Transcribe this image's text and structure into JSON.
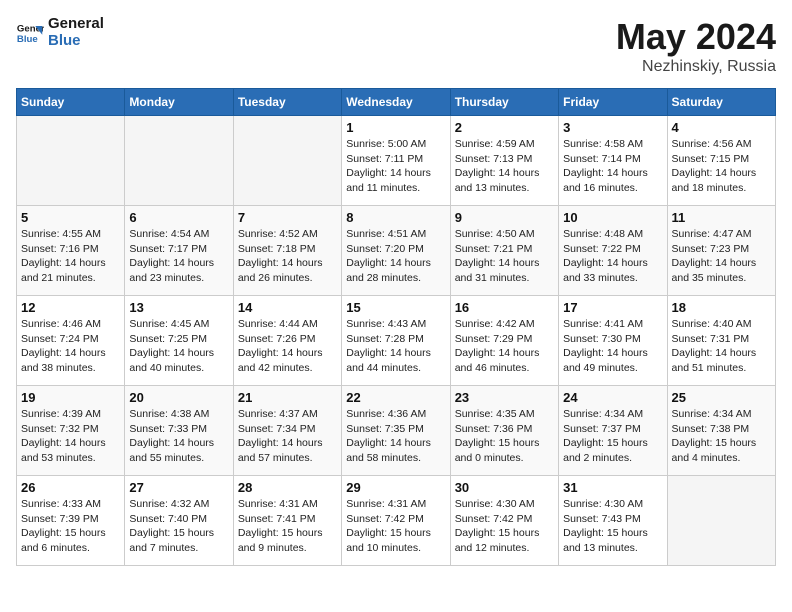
{
  "header": {
    "logo_line1": "General",
    "logo_line2": "Blue",
    "title": "May 2024",
    "location": "Nezhinskiy, Russia"
  },
  "weekdays": [
    "Sunday",
    "Monday",
    "Tuesday",
    "Wednesday",
    "Thursday",
    "Friday",
    "Saturday"
  ],
  "weeks": [
    [
      {
        "day": "",
        "empty": true
      },
      {
        "day": "",
        "empty": true
      },
      {
        "day": "",
        "empty": true
      },
      {
        "day": "1",
        "sunrise": "5:00 AM",
        "sunset": "7:11 PM",
        "daylight": "14 hours and 11 minutes."
      },
      {
        "day": "2",
        "sunrise": "4:59 AM",
        "sunset": "7:13 PM",
        "daylight": "14 hours and 13 minutes."
      },
      {
        "day": "3",
        "sunrise": "4:58 AM",
        "sunset": "7:14 PM",
        "daylight": "14 hours and 16 minutes."
      },
      {
        "day": "4",
        "sunrise": "4:56 AM",
        "sunset": "7:15 PM",
        "daylight": "14 hours and 18 minutes."
      }
    ],
    [
      {
        "day": "5",
        "sunrise": "4:55 AM",
        "sunset": "7:16 PM",
        "daylight": "14 hours and 21 minutes."
      },
      {
        "day": "6",
        "sunrise": "4:54 AM",
        "sunset": "7:17 PM",
        "daylight": "14 hours and 23 minutes."
      },
      {
        "day": "7",
        "sunrise": "4:52 AM",
        "sunset": "7:18 PM",
        "daylight": "14 hours and 26 minutes."
      },
      {
        "day": "8",
        "sunrise": "4:51 AM",
        "sunset": "7:20 PM",
        "daylight": "14 hours and 28 minutes."
      },
      {
        "day": "9",
        "sunrise": "4:50 AM",
        "sunset": "7:21 PM",
        "daylight": "14 hours and 31 minutes."
      },
      {
        "day": "10",
        "sunrise": "4:48 AM",
        "sunset": "7:22 PM",
        "daylight": "14 hours and 33 minutes."
      },
      {
        "day": "11",
        "sunrise": "4:47 AM",
        "sunset": "7:23 PM",
        "daylight": "14 hours and 35 minutes."
      }
    ],
    [
      {
        "day": "12",
        "sunrise": "4:46 AM",
        "sunset": "7:24 PM",
        "daylight": "14 hours and 38 minutes."
      },
      {
        "day": "13",
        "sunrise": "4:45 AM",
        "sunset": "7:25 PM",
        "daylight": "14 hours and 40 minutes."
      },
      {
        "day": "14",
        "sunrise": "4:44 AM",
        "sunset": "7:26 PM",
        "daylight": "14 hours and 42 minutes."
      },
      {
        "day": "15",
        "sunrise": "4:43 AM",
        "sunset": "7:28 PM",
        "daylight": "14 hours and 44 minutes."
      },
      {
        "day": "16",
        "sunrise": "4:42 AM",
        "sunset": "7:29 PM",
        "daylight": "14 hours and 46 minutes."
      },
      {
        "day": "17",
        "sunrise": "4:41 AM",
        "sunset": "7:30 PM",
        "daylight": "14 hours and 49 minutes."
      },
      {
        "day": "18",
        "sunrise": "4:40 AM",
        "sunset": "7:31 PM",
        "daylight": "14 hours and 51 minutes."
      }
    ],
    [
      {
        "day": "19",
        "sunrise": "4:39 AM",
        "sunset": "7:32 PM",
        "daylight": "14 hours and 53 minutes."
      },
      {
        "day": "20",
        "sunrise": "4:38 AM",
        "sunset": "7:33 PM",
        "daylight": "14 hours and 55 minutes."
      },
      {
        "day": "21",
        "sunrise": "4:37 AM",
        "sunset": "7:34 PM",
        "daylight": "14 hours and 57 minutes."
      },
      {
        "day": "22",
        "sunrise": "4:36 AM",
        "sunset": "7:35 PM",
        "daylight": "14 hours and 58 minutes."
      },
      {
        "day": "23",
        "sunrise": "4:35 AM",
        "sunset": "7:36 PM",
        "daylight": "15 hours and 0 minutes."
      },
      {
        "day": "24",
        "sunrise": "4:34 AM",
        "sunset": "7:37 PM",
        "daylight": "15 hours and 2 minutes."
      },
      {
        "day": "25",
        "sunrise": "4:34 AM",
        "sunset": "7:38 PM",
        "daylight": "15 hours and 4 minutes."
      }
    ],
    [
      {
        "day": "26",
        "sunrise": "4:33 AM",
        "sunset": "7:39 PM",
        "daylight": "15 hours and 6 minutes."
      },
      {
        "day": "27",
        "sunrise": "4:32 AM",
        "sunset": "7:40 PM",
        "daylight": "15 hours and 7 minutes."
      },
      {
        "day": "28",
        "sunrise": "4:31 AM",
        "sunset": "7:41 PM",
        "daylight": "15 hours and 9 minutes."
      },
      {
        "day": "29",
        "sunrise": "4:31 AM",
        "sunset": "7:42 PM",
        "daylight": "15 hours and 10 minutes."
      },
      {
        "day": "30",
        "sunrise": "4:30 AM",
        "sunset": "7:42 PM",
        "daylight": "15 hours and 12 minutes."
      },
      {
        "day": "31",
        "sunrise": "4:30 AM",
        "sunset": "7:43 PM",
        "daylight": "15 hours and 13 minutes."
      },
      {
        "day": "",
        "empty": true
      }
    ]
  ],
  "labels": {
    "sunrise": "Sunrise:",
    "sunset": "Sunset:",
    "daylight": "Daylight:"
  }
}
